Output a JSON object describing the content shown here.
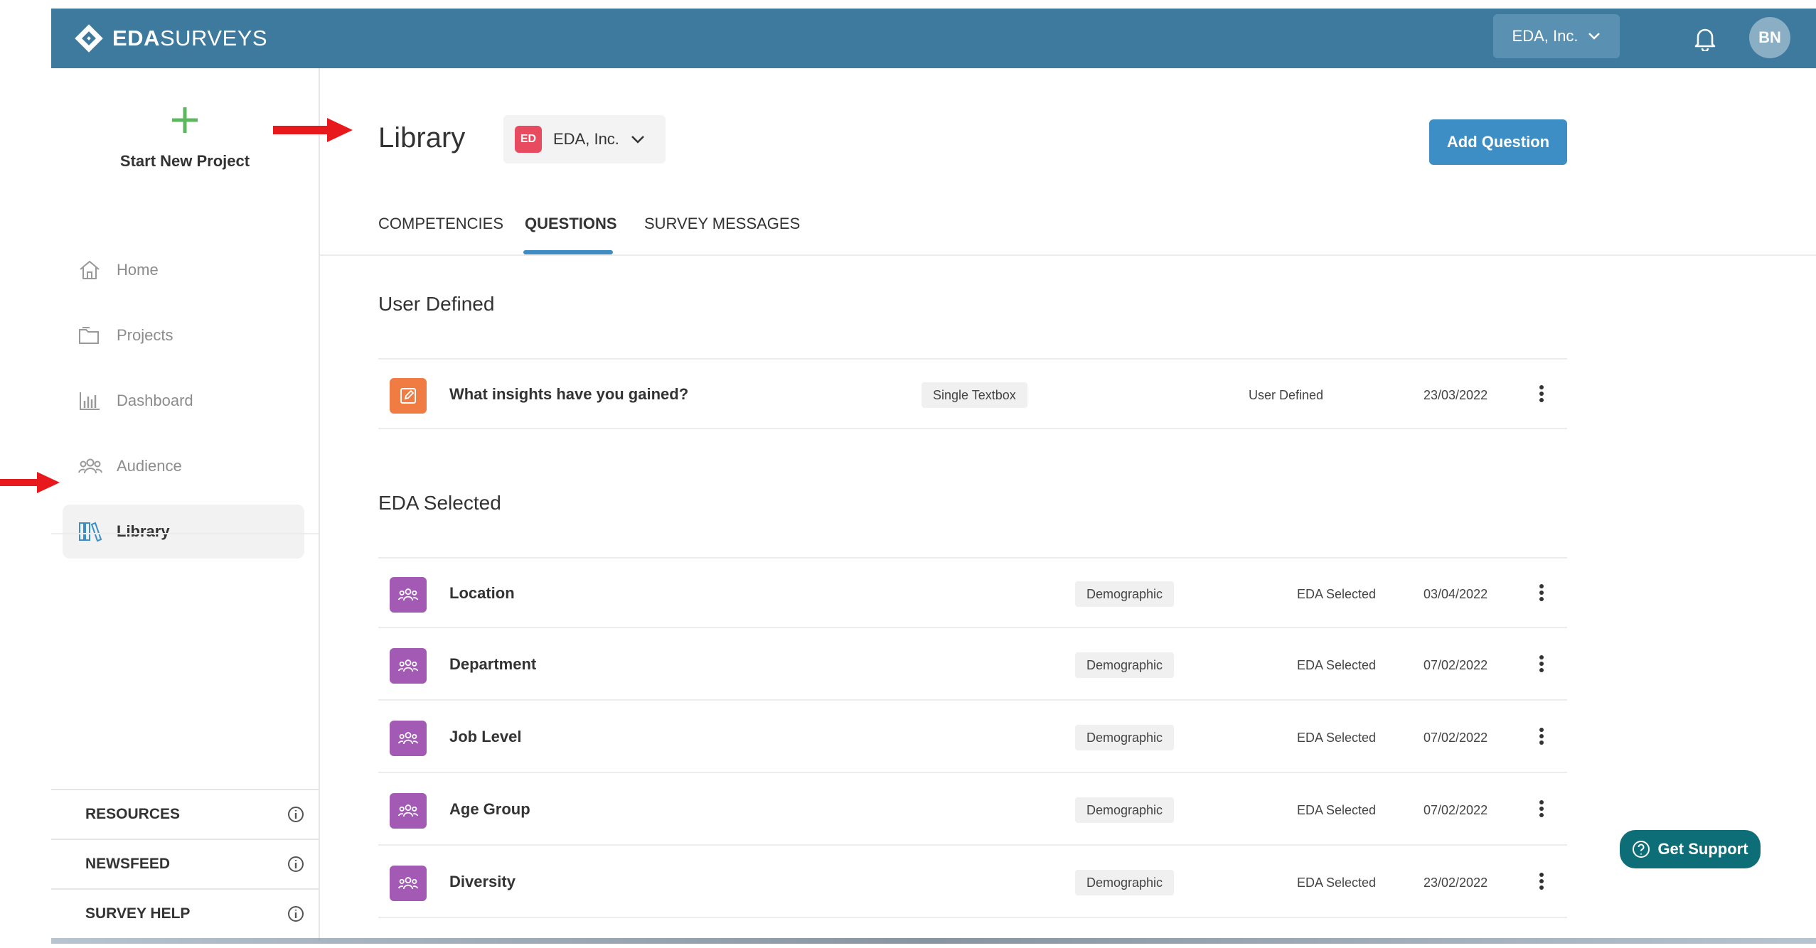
{
  "header": {
    "logo_bold": "EDA",
    "logo_light": "SURVEYS",
    "org_selector": "EDA, Inc.",
    "avatar_initials": "BN",
    "bg_color": "#3d7a9e"
  },
  "sidebar": {
    "new_project_label": "Start New Project",
    "items": [
      {
        "label": "Home",
        "icon": "home-icon"
      },
      {
        "label": "Projects",
        "icon": "folder-icon"
      },
      {
        "label": "Dashboard",
        "icon": "bar-chart-icon"
      },
      {
        "label": "Audience",
        "icon": "users-icon"
      },
      {
        "label": "Library",
        "icon": "library-icon",
        "active": true
      }
    ],
    "bottom_links": [
      {
        "label": "RESOURCES"
      },
      {
        "label": "NEWSFEED"
      },
      {
        "label": "SURVEY HELP"
      }
    ]
  },
  "main": {
    "title": "Library",
    "org_badge": "ED",
    "org_name": "EDA, Inc.",
    "add_button": "Add Question",
    "tabs": [
      {
        "label": "COMPETENCIES"
      },
      {
        "label": "QUESTIONS",
        "active": true
      },
      {
        "label": "SURVEY MESSAGES"
      }
    ],
    "sections": [
      {
        "title": "User Defined",
        "rows": [
          {
            "text": "What insights have you gained?",
            "type": "Single Textbox",
            "source": "User Defined",
            "date": "23/03/2022",
            "icon": "edit-icon",
            "icon_color": "#f07c43"
          }
        ]
      },
      {
        "title": "EDA Selected",
        "rows": [
          {
            "text": "Location",
            "type": "Demographic",
            "source": "EDA Selected",
            "date": "03/04/2022",
            "icon": "users-icon",
            "icon_color": "#a35ab5"
          },
          {
            "text": "Department",
            "type": "Demographic",
            "source": "EDA Selected",
            "date": "07/02/2022",
            "icon": "users-icon",
            "icon_color": "#a35ab5"
          },
          {
            "text": "Job Level",
            "type": "Demographic",
            "source": "EDA Selected",
            "date": "07/02/2022",
            "icon": "users-icon",
            "icon_color": "#a35ab5"
          },
          {
            "text": "Age Group",
            "type": "Demographic",
            "source": "EDA Selected",
            "date": "07/02/2022",
            "icon": "users-icon",
            "icon_color": "#a35ab5"
          },
          {
            "text": "Diversity",
            "type": "Demographic",
            "source": "EDA Selected",
            "date": "23/02/2022",
            "icon": "users-icon",
            "icon_color": "#a35ab5"
          }
        ]
      }
    ]
  },
  "support_button": "Get Support",
  "annotation_color": "#e8191c"
}
